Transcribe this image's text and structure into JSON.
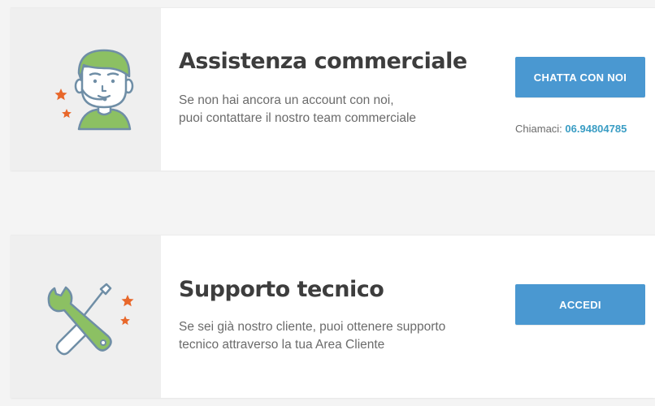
{
  "sections": [
    {
      "title": "Assistenza commerciale",
      "description_line1": "Se non hai ancora un account con noi,",
      "description_line2": "puoi contattare il nostro team commerciale",
      "button_label": "CHATTA CON NOI",
      "call_label": "Chiamaci:",
      "call_number": "06.94804785",
      "icon": "support-agent-icon"
    },
    {
      "title": "Supporto tecnico",
      "description_line1": "Se sei già nostro cliente, puoi ottenere supporto",
      "description_line2": "tecnico attraverso la tua Area Cliente",
      "button_label": "ACCEDI",
      "icon": "wrench-screwdriver-icon"
    }
  ],
  "colors": {
    "accent_button": "#4a98d1",
    "phone_link": "#3a9dc4",
    "icon_green": "#8cc063",
    "icon_outline": "#6f8ea6",
    "star_orange": "#e8672a",
    "page_background": "#f4f4f4",
    "icon_panel": "#efefef"
  }
}
